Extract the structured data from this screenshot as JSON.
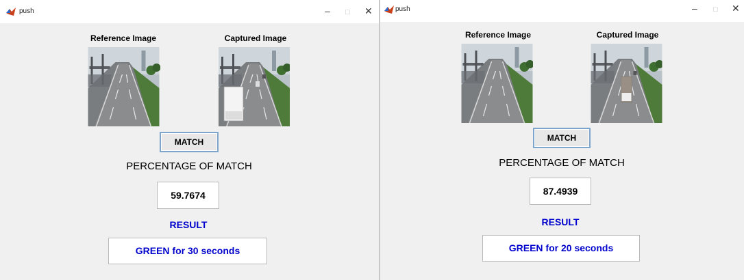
{
  "colors": {
    "result_blue": "#0000cc",
    "window_bg": "#f0f0f0"
  },
  "windows": [
    {
      "title": "push",
      "reference_label": "Reference Image",
      "captured_label": "Captured Image",
      "match_label": "MATCH",
      "percentage_label": "PERCENTAGE OF MATCH",
      "percentage_value": "59.7674",
      "result_label": "RESULT",
      "result_text": "GREEN for 30 seconds"
    },
    {
      "title": "push",
      "reference_label": "Reference Image",
      "captured_label": "Captured Image",
      "match_label": "MATCH",
      "percentage_label": "PERCENTAGE OF MATCH",
      "percentage_value": "87.4939",
      "result_label": "RESULT",
      "result_text": "GREEN for 20 seconds"
    }
  ],
  "window_controls": {
    "minimize": "–",
    "maximize": "□",
    "close": "✕"
  },
  "icons": {
    "app": "matlab-icon"
  }
}
